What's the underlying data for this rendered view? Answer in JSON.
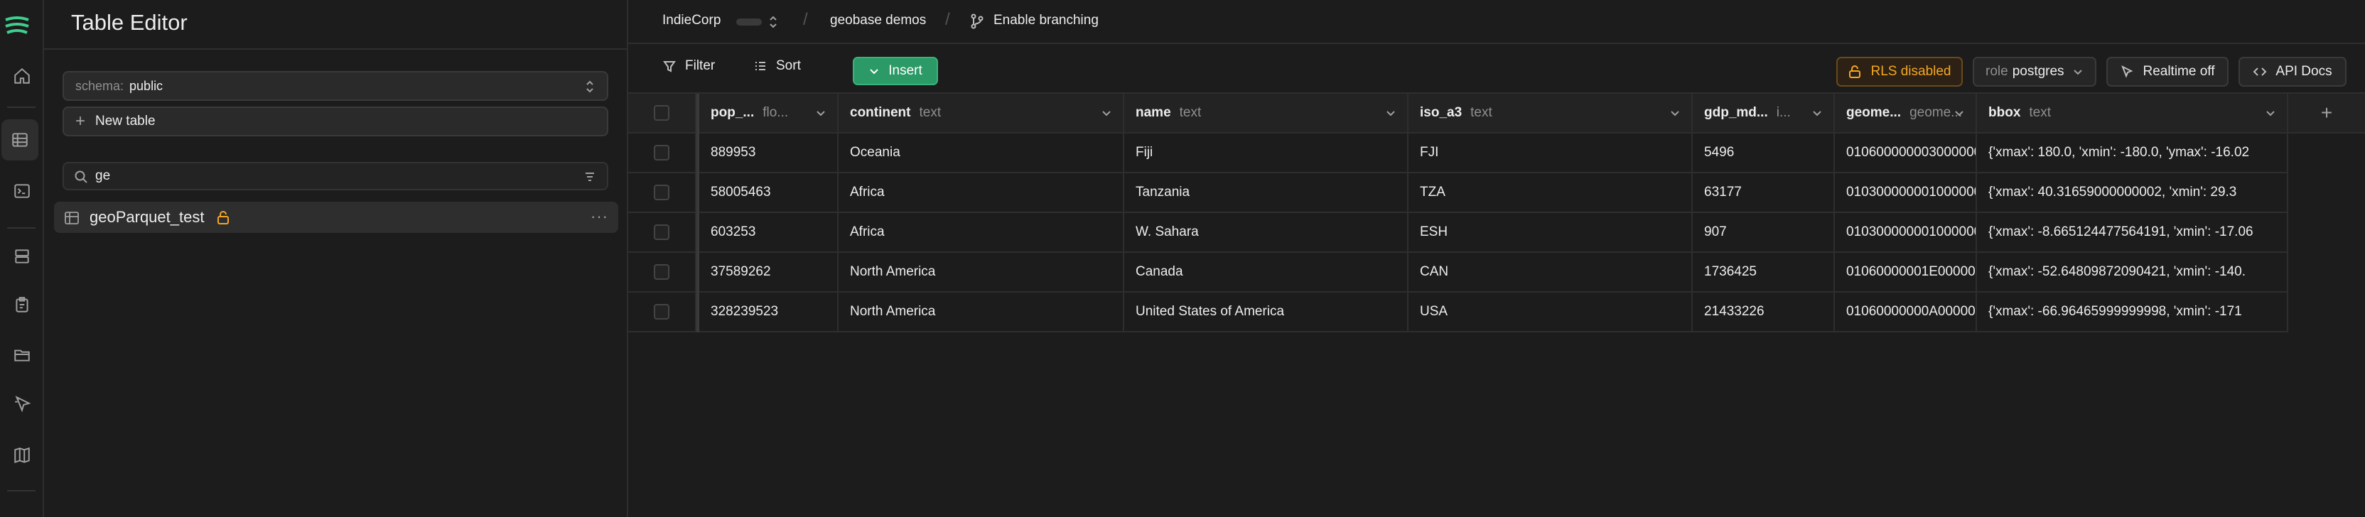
{
  "sidebar": {
    "title": "Table Editor",
    "schema_label": "schema:",
    "schema_value": "public",
    "new_table_label": "New table",
    "search_value": "ge",
    "tables": [
      {
        "name": "geoParquet_test"
      }
    ]
  },
  "breadcrumb": {
    "org": "IndieCorp",
    "project": "geobase demos",
    "branch": "Enable branching"
  },
  "toolbar": {
    "filter": "Filter",
    "sort": "Sort",
    "insert": "Insert",
    "rls": "RLS disabled",
    "role_label": "role",
    "role_value": "postgres",
    "realtime": "Realtime off",
    "api_docs": "API Docs"
  },
  "grid": {
    "columns": [
      {
        "name": "pop_...",
        "type": "flo..."
      },
      {
        "name": "continent",
        "type": "text"
      },
      {
        "name": "name",
        "type": "text"
      },
      {
        "name": "iso_a3",
        "type": "text"
      },
      {
        "name": "gdp_md...",
        "type": "i..."
      },
      {
        "name": "geome...",
        "type": "geome..."
      },
      {
        "name": "bbox",
        "type": "text"
      }
    ],
    "rows": [
      [
        "889953",
        "Oceania",
        "Fiji",
        "FJI",
        "5496",
        "0106000000030000000",
        "{'xmax': 180.0, 'xmin': -180.0, 'ymax': -16.02"
      ],
      [
        "58005463",
        "Africa",
        "Tanzania",
        "TZA",
        "63177",
        "0103000000010000003",
        "{'xmax': 40.31659000000002, 'xmin': 29.3"
      ],
      [
        "603253",
        "Africa",
        "W. Sahara",
        "ESH",
        "907",
        "0103000000010000001",
        "{'xmax': -8.665124477564191, 'xmin': -17.06"
      ],
      [
        "37589262",
        "North America",
        "Canada",
        "CAN",
        "1736425",
        "01060000001E0000000",
        "{'xmax': -52.64809872090421, 'xmin': -140."
      ],
      [
        "328239523",
        "North America",
        "United States of America",
        "USA",
        "21433226",
        "01060000000A0000000",
        "{'xmax': -66.96465999999998, 'xmin': -171"
      ]
    ]
  },
  "colors": {
    "accent_green": "#2b9a66",
    "warning_orange": "#f5a623",
    "background": "#1c1c1c"
  },
  "icons": {
    "logo": "supabase-logo-icon",
    "rail": [
      "home-icon",
      "table-editor-icon",
      "sql-editor-icon",
      "database-icon",
      "auth-icon",
      "storage-icon",
      "edge-functions-icon",
      "map-icon"
    ]
  }
}
